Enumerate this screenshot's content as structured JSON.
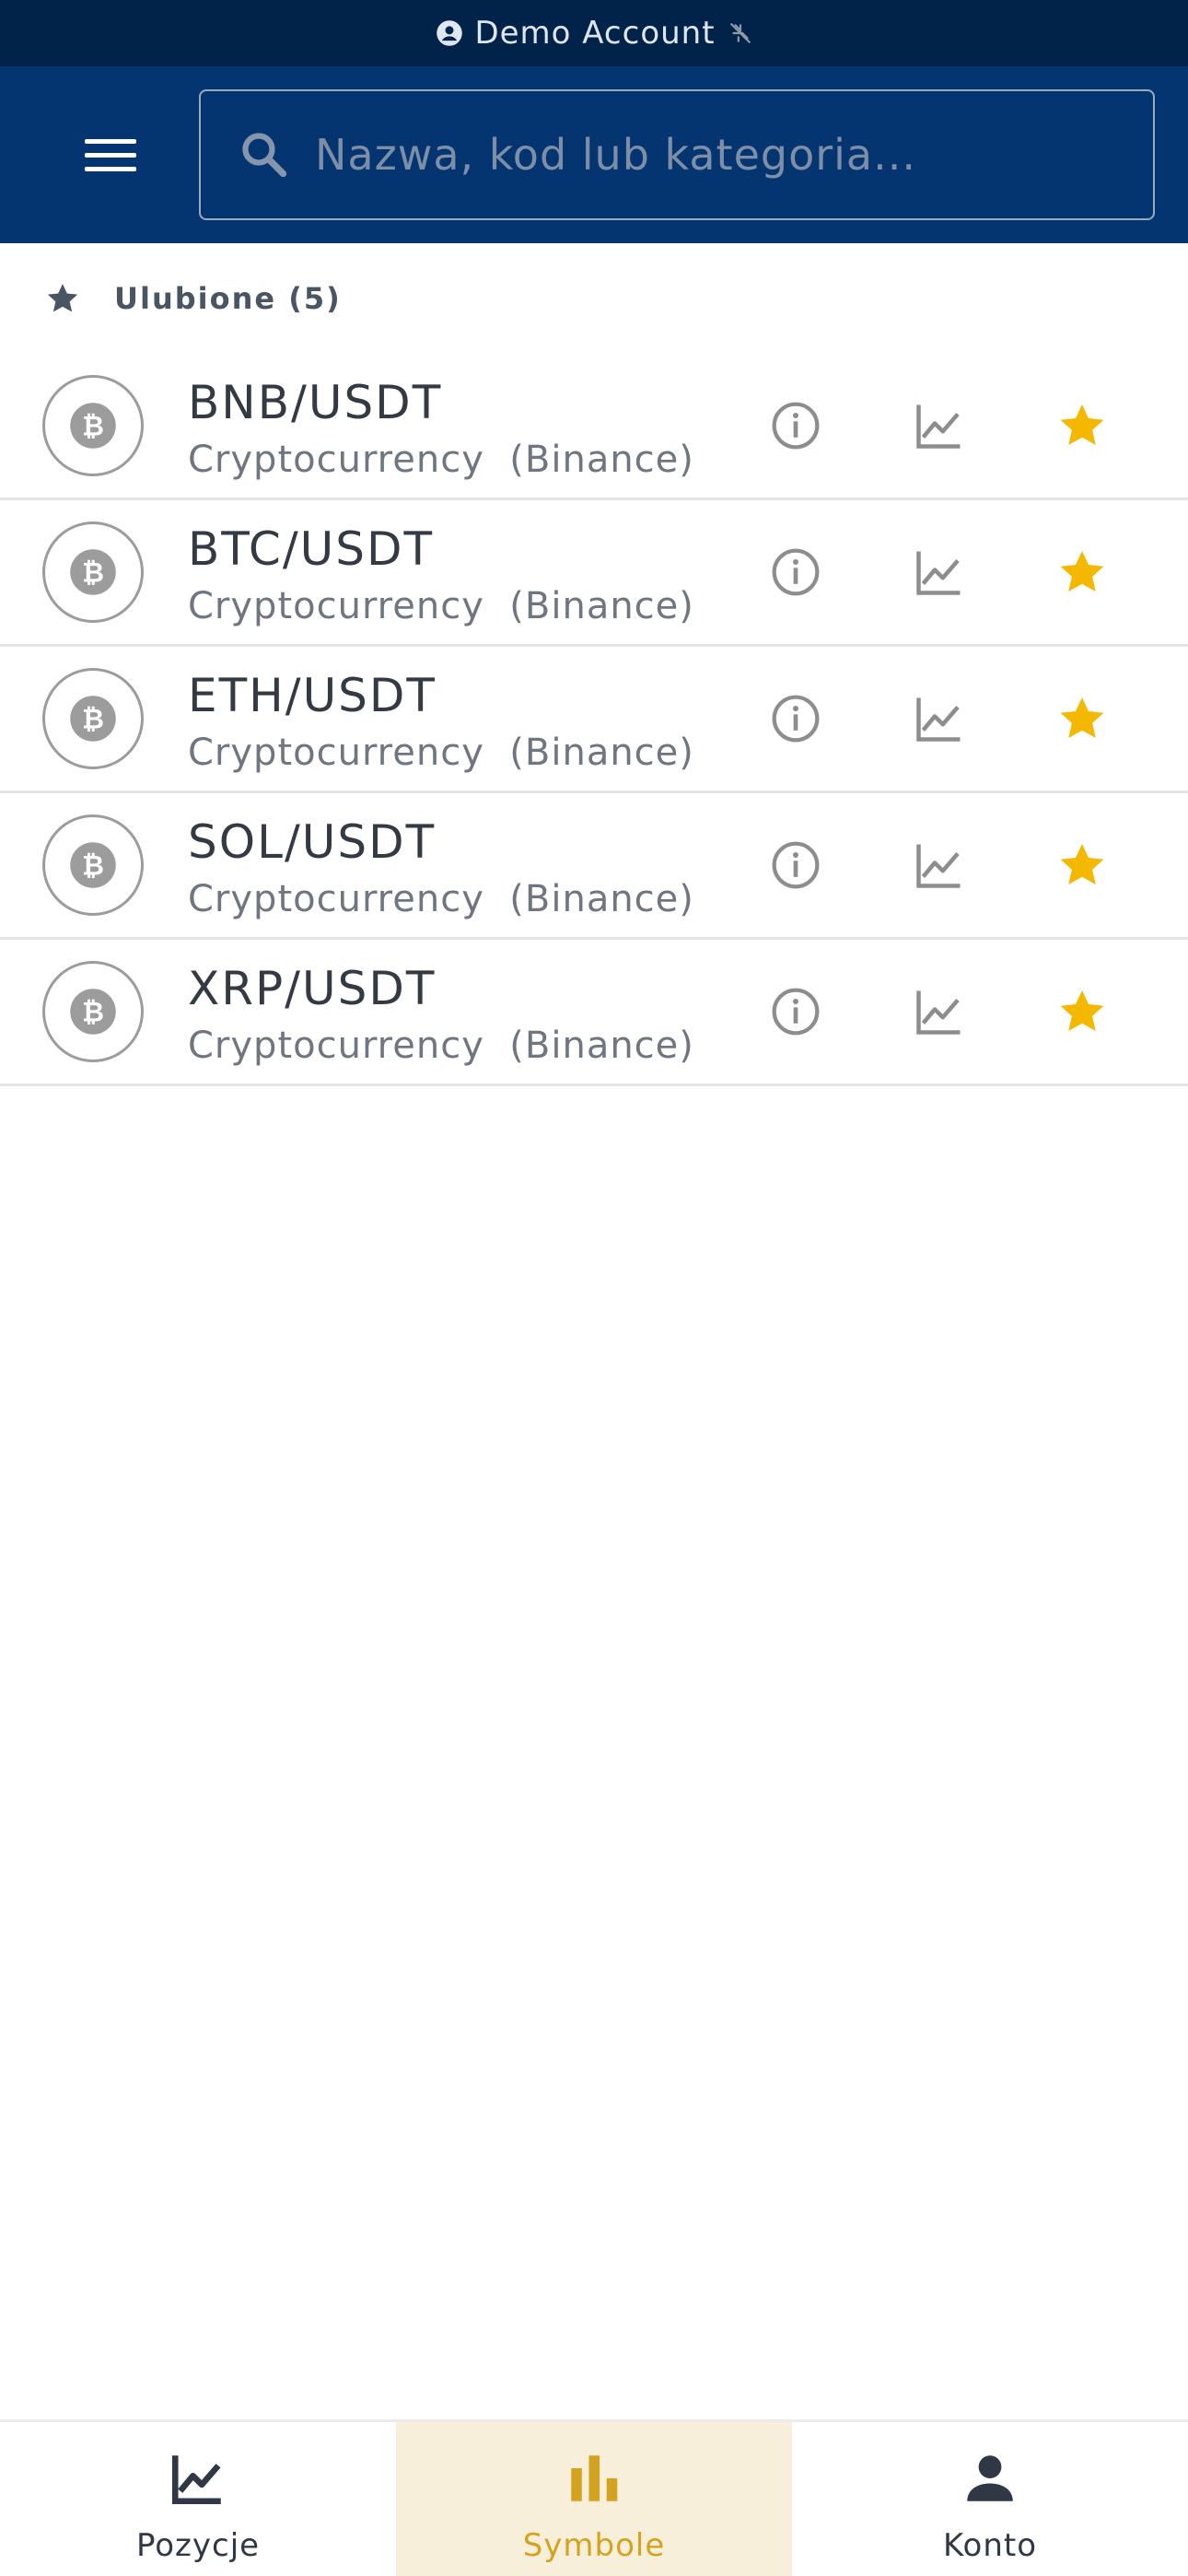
{
  "account_bar": {
    "label": "Demo Account",
    "icons": [
      "account-circle-icon",
      "no-connection-icon"
    ]
  },
  "header": {
    "search": {
      "placeholder": "Nazwa, kod lub kategoria...",
      "value": ""
    },
    "icons": [
      "menu-icon",
      "search-icon"
    ]
  },
  "favorites": {
    "label": "Ulubione (5)",
    "icon": "star-icon",
    "items": [
      {
        "symbol": "BNB/USDT",
        "category": "Cryptocurrency",
        "exchange": "(Binance)",
        "subtitle": "Cryptocurrency  (Binance)"
      },
      {
        "symbol": "BTC/USDT",
        "category": "Cryptocurrency",
        "exchange": "(Binance)",
        "subtitle": "Cryptocurrency  (Binance)"
      },
      {
        "symbol": "ETH/USDT",
        "category": "Cryptocurrency",
        "exchange": "(Binance)",
        "subtitle": "Cryptocurrency  (Binance)"
      },
      {
        "symbol": "SOL/USDT",
        "category": "Cryptocurrency",
        "exchange": "(Binance)",
        "subtitle": "Cryptocurrency  (Binance)"
      },
      {
        "symbol": "XRP/USDT",
        "category": "Cryptocurrency",
        "exchange": "(Binance)",
        "subtitle": "Cryptocurrency  (Binance)"
      }
    ],
    "row_icons": [
      "bitcoin-icon",
      "info-icon",
      "chart-line-icon",
      "star-icon"
    ]
  },
  "bottom_nav": {
    "items": [
      {
        "label": "Pozycje",
        "icon": "chart-line-icon",
        "active": false
      },
      {
        "label": "Symbole",
        "icon": "bar-chart-icon",
        "active": true
      },
      {
        "label": "Konto",
        "icon": "person-icon",
        "active": false
      }
    ]
  },
  "colors": {
    "account_bar_bg": "#01234a",
    "header_bg": "#043571",
    "favorite_star": "#f5b800",
    "active_nav_bg": "#f8efdb",
    "active_nav_fg": "#d3a21e"
  }
}
